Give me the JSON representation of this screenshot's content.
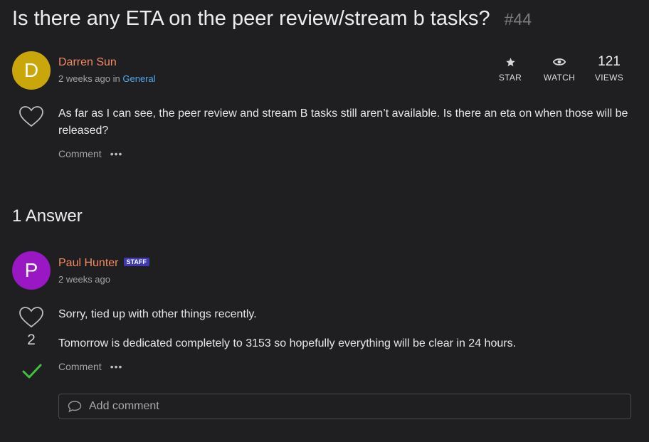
{
  "question": {
    "title": "Is there any ETA on the peer review/stream b tasks?",
    "number": "#44",
    "author": {
      "initial": "D",
      "name": "Darren Sun",
      "avatar_color": "#c9a60a"
    },
    "time": "2 weeks ago",
    "in_text": "in",
    "category": "General",
    "stats": {
      "star_label": "STAR",
      "watch_label": "WATCH",
      "views_count": "121",
      "views_label": "VIEWS"
    },
    "body": "As far as I can see, the peer review and stream B tasks still aren’t available. Is there an eta on when those will be released?",
    "comment_label": "Comment",
    "more": "•••"
  },
  "answers": {
    "heading": "1 Answer",
    "items": [
      {
        "author": {
          "initial": "P",
          "name": "Paul Hunter",
          "avatar_color": "#9a17c4"
        },
        "badge": "STAFF",
        "time": "2 weeks ago",
        "votes": "2",
        "paragraphs": [
          "Sorry, tied up with other things recently.",
          "Tomorrow is dedicated completely to 3153 so hopefully everything will be clear in 24 hours."
        ],
        "comment_label": "Comment",
        "more": "•••",
        "accepted_color": "#3ec33e"
      }
    ]
  },
  "add_comment": {
    "placeholder": "Add comment"
  },
  "colors": {
    "author": "#f28a63",
    "category_link": "#55a6e8",
    "background": "#1f1e20"
  }
}
